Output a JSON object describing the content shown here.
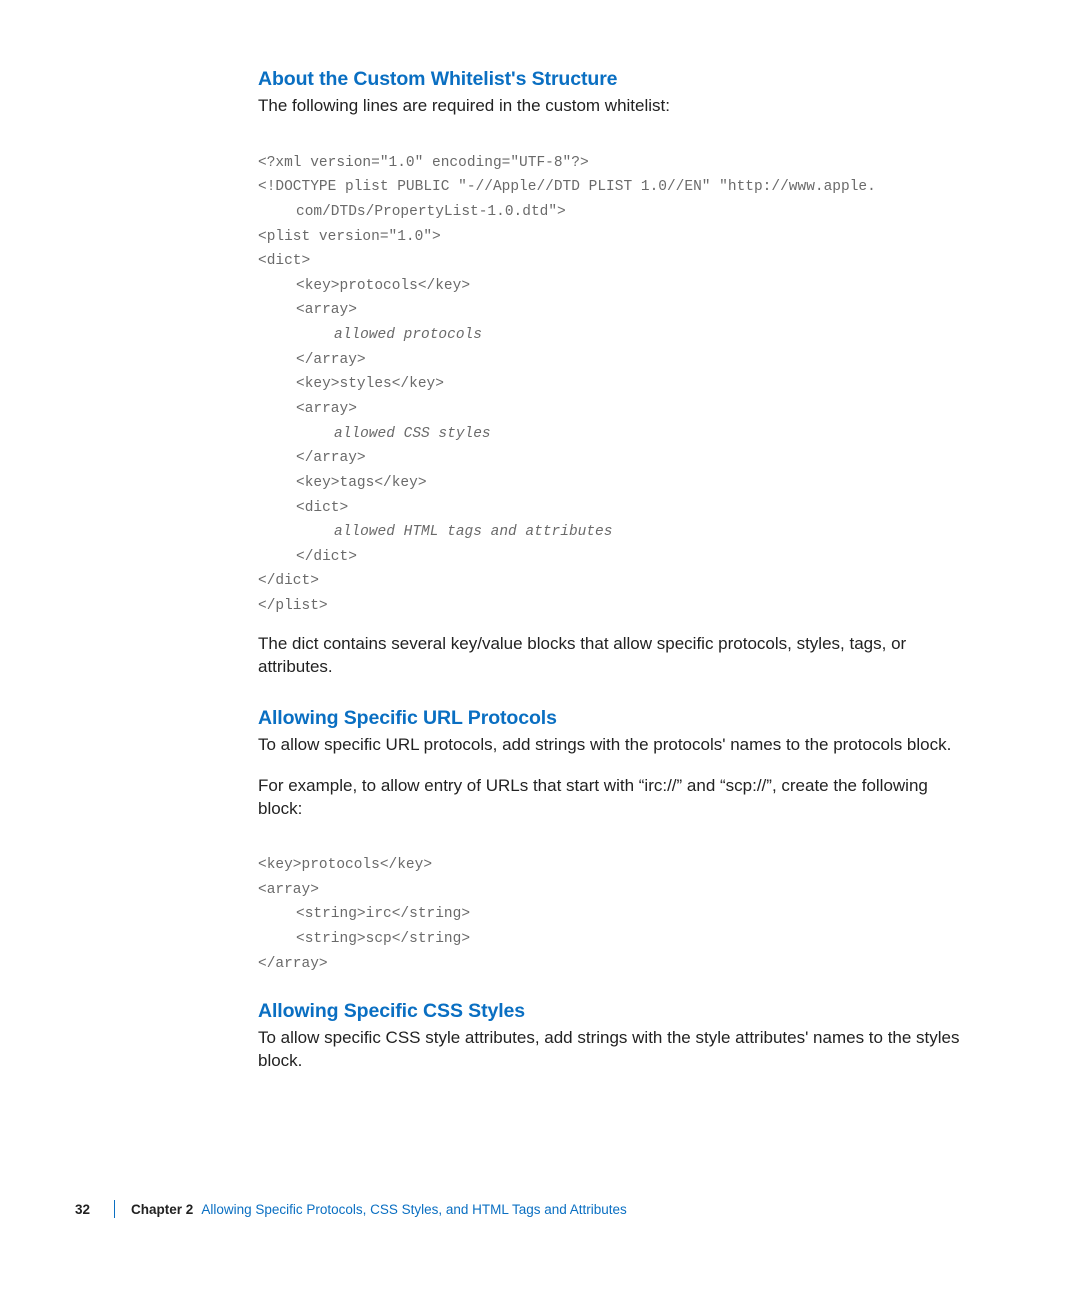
{
  "sections": {
    "about": {
      "heading": "About the Custom Whitelist's Structure",
      "intro": "The following lines are required in the custom whitelist:",
      "code": {
        "l00": "<?xml version=\"1.0\" encoding=\"UTF-8\"?>",
        "l01a": "<!DOCTYPE plist PUBLIC \"-//Apple//DTD PLIST 1.0//EN\" \"http://www.apple.",
        "l01b": "com/DTDs/PropertyList-1.0.dtd\">",
        "l02": "<plist version=\"1.0\">",
        "l03": "<dict>",
        "l04": "<key>protocols</key>",
        "l05": "<array>",
        "l06": "allowed protocols",
        "l07": "</array>",
        "l08": "<key>styles</key>",
        "l09": "<array>",
        "l10": "allowed CSS styles",
        "l11": "</array>",
        "l12": "<key>tags</key>",
        "l13": "<dict>",
        "l14": "allowed HTML tags and attributes",
        "l15": "</dict>",
        "l16": "</dict>",
        "l17": "</plist>"
      },
      "after": "The dict contains several key/value blocks that allow specific protocols, styles, tags, or attributes."
    },
    "protocols": {
      "heading": "Allowing Specific URL Protocols",
      "p1": "To allow specific URL protocols, add strings with the protocols' names to the protocols block.",
      "p2": "For example, to allow entry of URLs that start with “irc://” and “scp://”, create the following block:",
      "code": {
        "l0": "<key>protocols</key>",
        "l1": "<array>",
        "l2": "<string>irc</string>",
        "l3": "<string>scp</string>",
        "l4": "</array>"
      }
    },
    "css": {
      "heading": "Allowing Specific CSS Styles",
      "p1": "To allow specific CSS style attributes, add strings with the style attributes' names to the styles block."
    }
  },
  "footer": {
    "page_number": "32",
    "chapter_label": "Chapter 2",
    "chapter_title": "Allowing Specific Protocols, CSS Styles, and HTML Tags and Attributes"
  }
}
